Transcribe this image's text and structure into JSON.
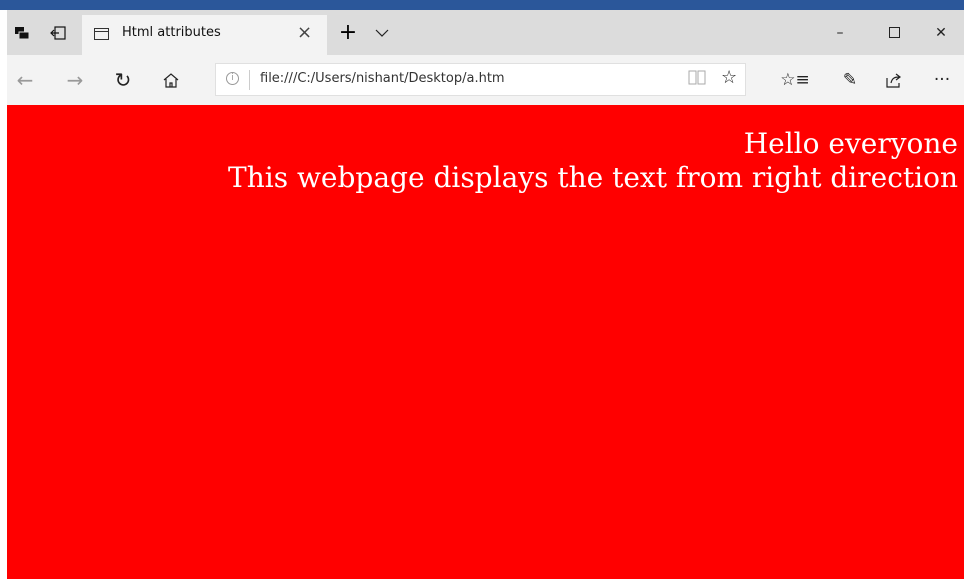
{
  "browser": {
    "tab": {
      "title": "Html attributes"
    },
    "new_tab_icon": "plus-icon",
    "tab_list_icon": "chevron-down-icon",
    "window_controls": {
      "minimize": "–",
      "maximize": "☐",
      "close": "✕"
    },
    "address": {
      "url": "file:///C:/Users/nishant/Desktop/a.htm"
    },
    "nav": {
      "back": "←",
      "forward": "→",
      "refresh": "↻",
      "home": "⌂"
    },
    "toolbar": {
      "favorites": "☆≡",
      "notes": "✎",
      "share": "⇪",
      "more": "···"
    }
  },
  "page": {
    "background_color": "#ff0000",
    "text_color": "#ffffff",
    "line1": "Hello everyone",
    "line2": "This webpage displays the text from right direction"
  }
}
